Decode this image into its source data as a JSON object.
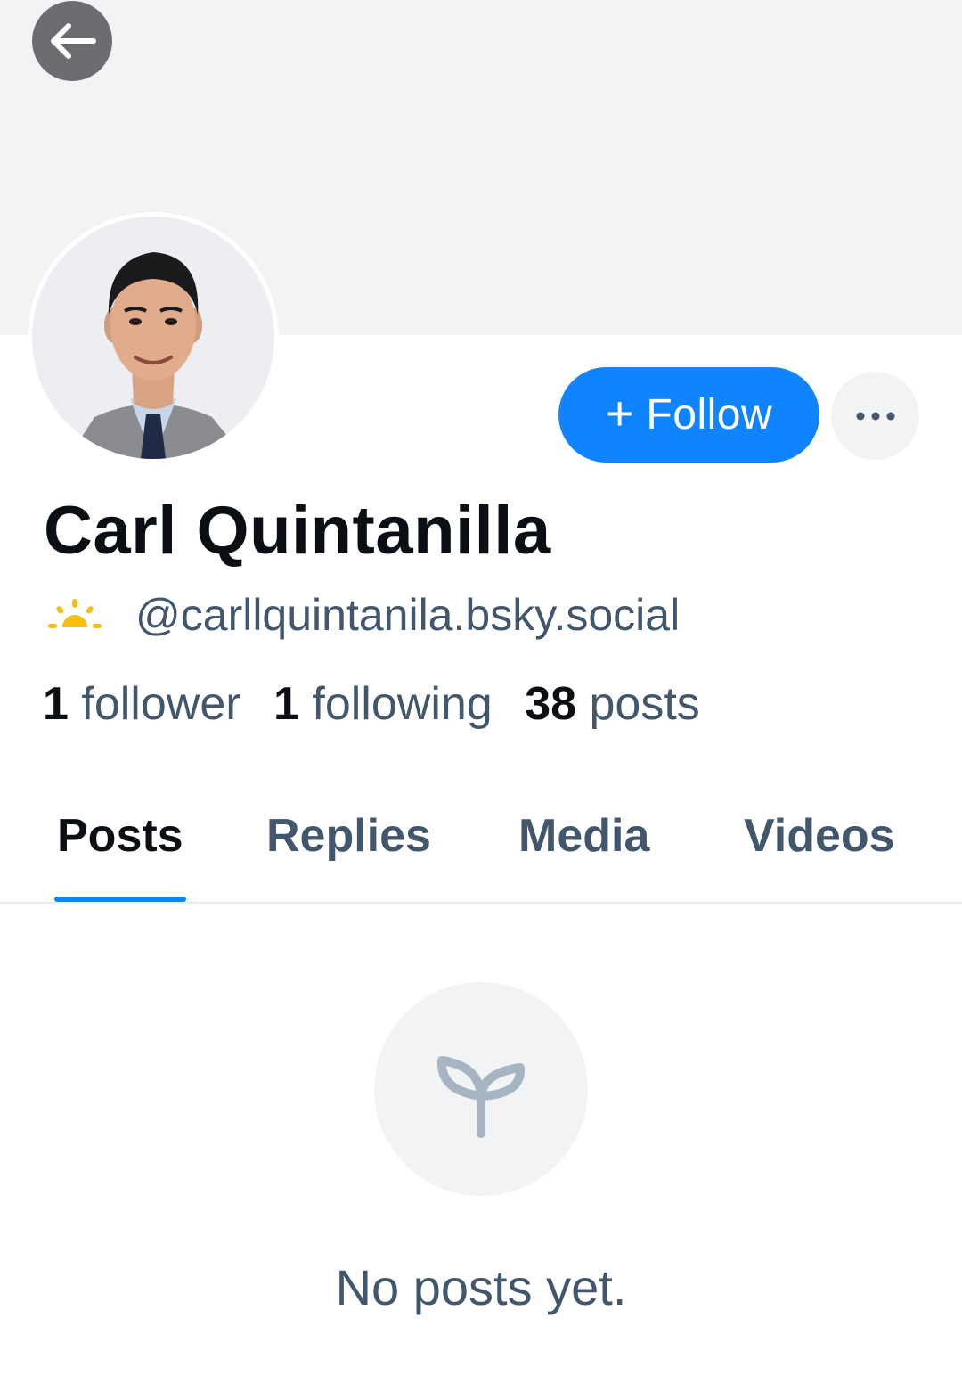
{
  "profile": {
    "display_name": "Carl Quintanilla",
    "handle": "@carllquintanila.bsky.social",
    "avatar_alt": "profile photo"
  },
  "actions": {
    "follow_plus": "+",
    "follow_label": "Follow"
  },
  "stats": {
    "followers_count": "1",
    "followers_label": "follower",
    "following_count": "1",
    "following_label": "following",
    "posts_count": "38",
    "posts_label": "posts"
  },
  "tabs": [
    {
      "label": "Posts",
      "active": true
    },
    {
      "label": "Replies",
      "active": false
    },
    {
      "label": "Media",
      "active": false
    },
    {
      "label": "Videos",
      "active": false
    }
  ],
  "feed": {
    "empty_message": "No posts yet."
  },
  "icons": {
    "back": "arrow-left-icon",
    "more": "ellipsis-icon",
    "handle_badge": "sunrise-icon",
    "empty": "sprout-icon"
  },
  "colors": {
    "accent": "#1083fe",
    "banner": "#f1f3f5",
    "text_primary": "#0b0f14",
    "text_secondary": "#42576c",
    "badge": "#f7be12"
  }
}
